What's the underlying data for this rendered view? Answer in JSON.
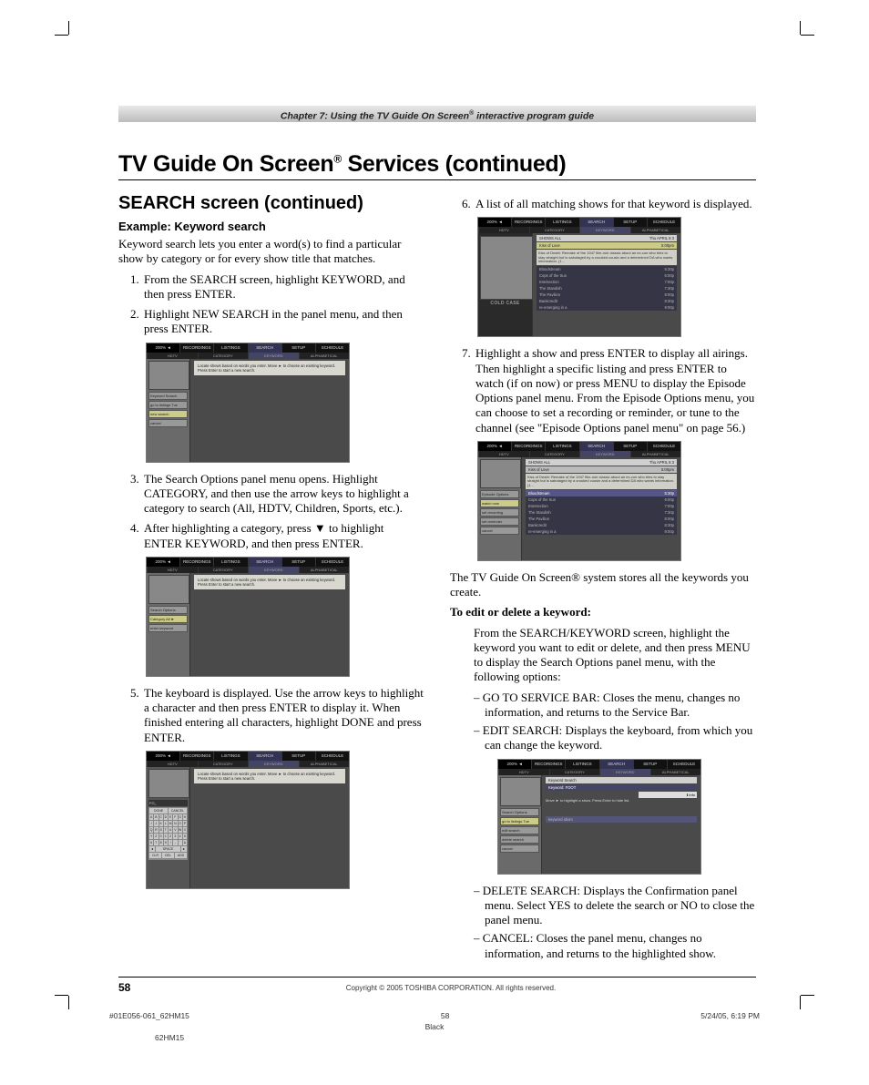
{
  "chapter_bar": "Chapter 7: Using the TV Guide On Screen® interactive program guide",
  "title_pre": "TV Guide On Screen",
  "title_post": " Services (continued)",
  "subheading": "SEARCH screen (continued)",
  "example_heading": "Example: Keyword search",
  "intro": "Keyword search lets you enter a word(s) to find a particular show by category or for every show title that matches.",
  "steps_left": {
    "s1": "From the SEARCH screen, highlight KEYWORD, and then press ENTER.",
    "s2": "Highlight NEW SEARCH in the panel menu, and then press ENTER.",
    "s3": "The Search Options panel menu opens. Highlight CATEGORY, and then use the arrow keys to highlight a category to search (All, HDTV, Children, Sports, etc.).",
    "s4": "After highlighting a category, press ▼ to highlight ENTER KEYWORD, and then press ENTER.",
    "s5": "The keyboard is displayed. Use the arrow keys to highlight a character and then press ENTER to display it. When finished entering all characters, highlight DONE and press ENTER."
  },
  "steps_right": {
    "s6": "A list of all matching shows for that keyword is displayed.",
    "s7": "Highlight a show and press ENTER to display all airings. Then highlight a specific listing and press ENTER to watch (if on now) or press MENU to display the Episode Options panel menu. From the Episode Options menu, you can choose to set a recording or reminder, or tune to the channel (see \"Episode Options panel menu\" on page 56.)"
  },
  "store_text": "The TV Guide On Screen® system stores all the keywords you create.",
  "edit_heading": "To edit or delete a keyword:",
  "edit_intro": "From the SEARCH/KEYWORD screen, highlight the keyword you want to edit or delete, and then press MENU to display the Search Options panel menu, with the following options:",
  "edit_options": {
    "o1": "GO TO SERVICE BAR: Closes the menu, changes no information, and returns to the Service Bar.",
    "o2": "EDIT SEARCH: Displays the keyboard, from which you can change the keyword.",
    "o3": "DELETE SEARCH: Displays the Confirmation panel menu. Select YES to delete the search or NO to close the panel menu.",
    "o4": "CANCEL: Closes the panel menu, changes no information, and returns to the highlighted show."
  },
  "screenshots": {
    "menu_items": [
      "200% ◄",
      "RECORDINGS",
      "LISTINGS",
      "SEARCH",
      "SETUP",
      "SCHEDULE"
    ],
    "tab_items": [
      "HDTV",
      "CATEGORY",
      "KEYWORD",
      "ALPHABETICAL"
    ],
    "hint_text": "Locate shows based on words you enter.\nMove ► to choose an existing keyword.\nPress Enter to start a new search.",
    "side_labels": [
      "Keyword Search",
      "go to listings Tue",
      "new search",
      "cancel"
    ],
    "side_labels_b": [
      "Search Options",
      "Category All ►",
      "enter keyword"
    ],
    "side_labels_c": [
      "Search Options",
      "go to listings Tue",
      "edit search",
      "delete search",
      "cancel"
    ],
    "cold_case": "COLD CASE",
    "result_header_left": "SHOWS ALL",
    "result_header_right": "Thu APRIL 8 3",
    "result_title": "Kiss of Love",
    "result_time": "5:00pm",
    "result_desc": "Kiss of Death: Remake of the 1947 film-noir classic about an ex-con who tries to stay straight but is sabotaged by a crooked cousin and a determined DA who wants information. (1...",
    "keyword_box": "Keyword: FOOT",
    "keyword_hint": "Move ► to highlight a show.\nPress Enter to hide list.",
    "keyword_row": "keyword idiom"
  },
  "footer": {
    "page_number": "58",
    "copyright": "Copyright © 2005 TOSHIBA CORPORATION. All rights reserved."
  },
  "imprint": {
    "file": "#01E056-061_62HM15",
    "mid": "58",
    "date": "5/24/05, 6:19 PM",
    "color": "Black",
    "model": "62HM15"
  }
}
